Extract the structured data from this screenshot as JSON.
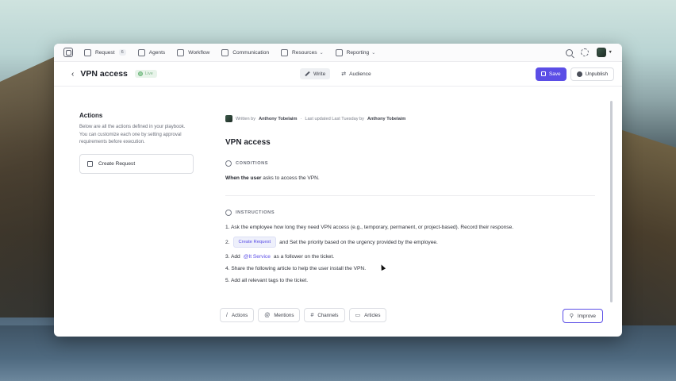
{
  "nav": {
    "items": [
      {
        "label": "Request",
        "badge": "6",
        "icon": "inbox-icon"
      },
      {
        "label": "Agents",
        "icon": "agents-icon"
      },
      {
        "label": "Workflow",
        "icon": "workflow-icon"
      },
      {
        "label": "Communication",
        "icon": "megaphone-icon"
      },
      {
        "label": "Resources",
        "icon": "layers-icon",
        "dropdown": true
      },
      {
        "label": "Reporting",
        "icon": "chart-icon",
        "dropdown": true
      }
    ]
  },
  "header": {
    "back": "‹",
    "title": "VPN access",
    "status": "Live",
    "tabs": {
      "write": "Write",
      "audience": "Audience"
    },
    "save_label": "Save",
    "unpublish_label": "Unpublish"
  },
  "sidebar": {
    "title": "Actions",
    "description": "Below are all the actions defined in your playbook. You can customize each one by setting approval requirements before execution.",
    "action_label": "Create Request"
  },
  "doc": {
    "meta": {
      "written_by": "Written by",
      "author": "Anthony Tobelaim",
      "sep": "·",
      "updated": "Last updated Last Tuesday by",
      "updater": "Anthony Tobelaim"
    },
    "title": "VPN access",
    "conditions": {
      "heading": "CONDITIONS",
      "when": "When the user",
      "rest": "asks to access the VPN."
    },
    "instructions": {
      "heading": "INSTRUCTIONS",
      "step1": "1. Ask the employee how long they need VPN access (e.g., temporary, permanent, or project-based). Record their response.",
      "step2_num": "2.",
      "step2_chip": "Create Request",
      "step2_rest": "and Set the priority based on the urgency provided by the employee.",
      "step3_pre": "3. Add",
      "step3_mention": "@It Service",
      "step3_post": "as a follower on the ticket.",
      "step4": "4. Share the following article to help the user install the VPN.",
      "step5": "5. Add all relevant tags to the ticket."
    }
  },
  "bottombar": {
    "actions": "Actions",
    "mentions": "Mentions",
    "channels": "Channels",
    "articles": "Articles",
    "improve": "Improve"
  },
  "colors": {
    "accent": "#5b4ee6",
    "status_bg": "#e8f4ea"
  }
}
